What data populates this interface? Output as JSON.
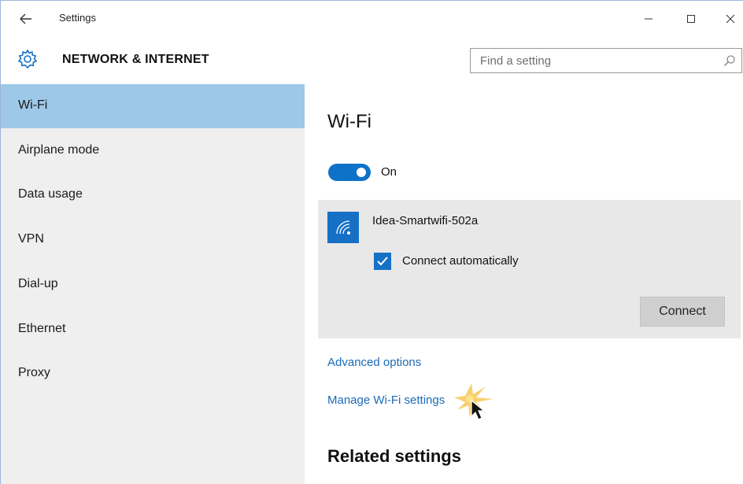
{
  "titlebar": {
    "title": "Settings",
    "back_icon": "back-arrow-icon",
    "minimize_icon": "minimize-icon",
    "maximize_icon": "maximize-icon",
    "close_icon": "close-icon"
  },
  "header": {
    "title": "NETWORK & INTERNET",
    "icon": "gear-icon",
    "search": {
      "placeholder": "Find a setting",
      "icon": "search-icon"
    }
  },
  "sidebar": {
    "items": [
      {
        "label": "Wi-Fi",
        "active": true
      },
      {
        "label": "Airplane mode"
      },
      {
        "label": "Data usage"
      },
      {
        "label": "VPN"
      },
      {
        "label": "Dial-up"
      },
      {
        "label": "Ethernet"
      },
      {
        "label": "Proxy"
      }
    ]
  },
  "main": {
    "title": "Wi-Fi",
    "toggle": {
      "state_label": "On",
      "on": true
    },
    "network": {
      "name": "Idea-Smartwifi-502a",
      "icon": "wifi-signal-icon",
      "auto_connect_label": "Connect automatically",
      "auto_connect_checked": true,
      "connect_label": "Connect"
    },
    "links": {
      "advanced": "Advanced options",
      "manage": "Manage Wi-Fi settings"
    },
    "related_heading": "Related settings"
  },
  "colors": {
    "accent": "#1670c6",
    "sidebar_bg": "#efefef",
    "sidebar_active": "#9ec8e8",
    "link": "#1c6ab8",
    "card_bg": "#e8e8e8"
  }
}
